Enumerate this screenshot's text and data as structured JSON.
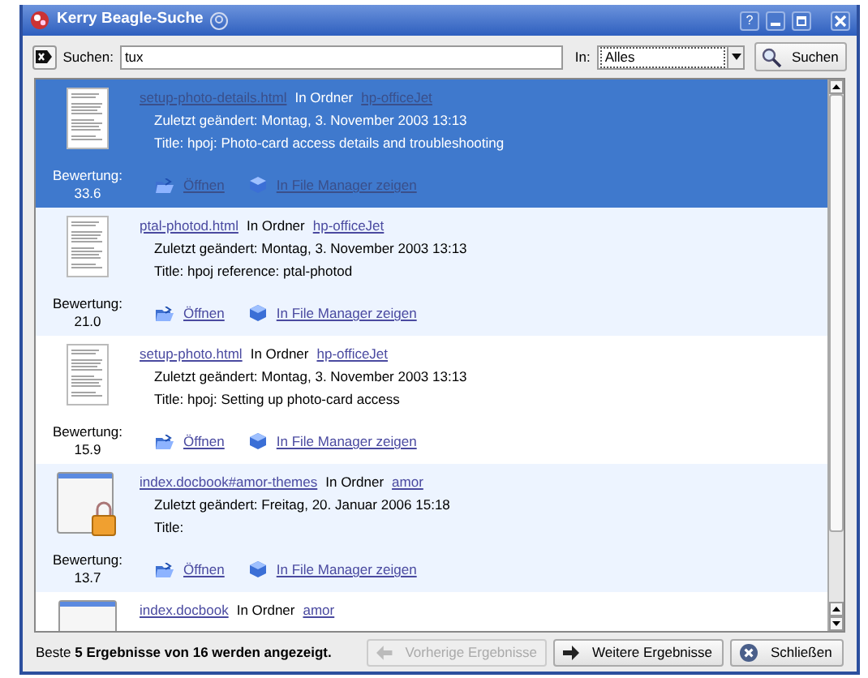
{
  "window": {
    "title": "Kerry Beagle-Suche",
    "help_button": "?"
  },
  "toolbar": {
    "search_label": "Suchen:",
    "search_value": "tux",
    "in_label": "In:",
    "scope": "Alles",
    "search_button": "Suchen"
  },
  "results": [
    {
      "kind": "document",
      "selected": true,
      "file": "setup-photo-details.html",
      "in_folder": "In Ordner",
      "folder": "hp-officeJet",
      "modified": "Zuletzt geändert: Montag, 3. November 2003 13:13",
      "title": "Title: hpoj: Photo-card access details and troubleshooting",
      "rating_label": "Bewertung:",
      "rating": "33.6",
      "open": "Öffnen",
      "show": "In File Manager zeigen"
    },
    {
      "kind": "document",
      "selected": false,
      "file": "ptal-photod.html",
      "in_folder": "In Ordner",
      "folder": "hp-officeJet",
      "modified": "Zuletzt geändert: Montag, 3. November 2003 13:13",
      "title": "Title: hpoj reference: ptal-photod",
      "rating_label": "Bewertung:",
      "rating": "21.0",
      "open": "Öffnen",
      "show": "In File Manager zeigen"
    },
    {
      "kind": "document",
      "selected": false,
      "file": "setup-photo.html",
      "in_folder": "In Ordner",
      "folder": "hp-officeJet",
      "modified": "Zuletzt geändert: Montag, 3. November 2003 13:13",
      "title": "Title: hpoj: Setting up photo-card access",
      "rating_label": "Bewertung:",
      "rating": "15.9",
      "open": "Öffnen",
      "show": "In File Manager zeigen"
    },
    {
      "kind": "locked",
      "selected": false,
      "file": "index.docbook#amor-themes",
      "in_folder": "In Ordner",
      "folder": "amor",
      "modified": "Zuletzt geändert: Freitag, 20. Januar 2006 15:18",
      "title": "Title:",
      "rating_label": "Bewertung:",
      "rating": "13.7",
      "open": "Öffnen",
      "show": "In File Manager zeigen"
    },
    {
      "kind": "page",
      "selected": false,
      "file": "index.docbook",
      "in_folder": "In Ordner",
      "folder": "amor"
    }
  ],
  "status_bar": {
    "text": "Beste **5 Ergebnisse von 16 werden angezeigt.**",
    "buttons": [
      {
        "label": "Vorherige Ergebnisse",
        "kind": "previous",
        "disabled": true
      },
      {
        "label": "Weitere Ergebnisse",
        "kind": "next",
        "disabled": false
      },
      {
        "label": "Schließen",
        "kind": "close",
        "disabled": false
      }
    ]
  }
}
